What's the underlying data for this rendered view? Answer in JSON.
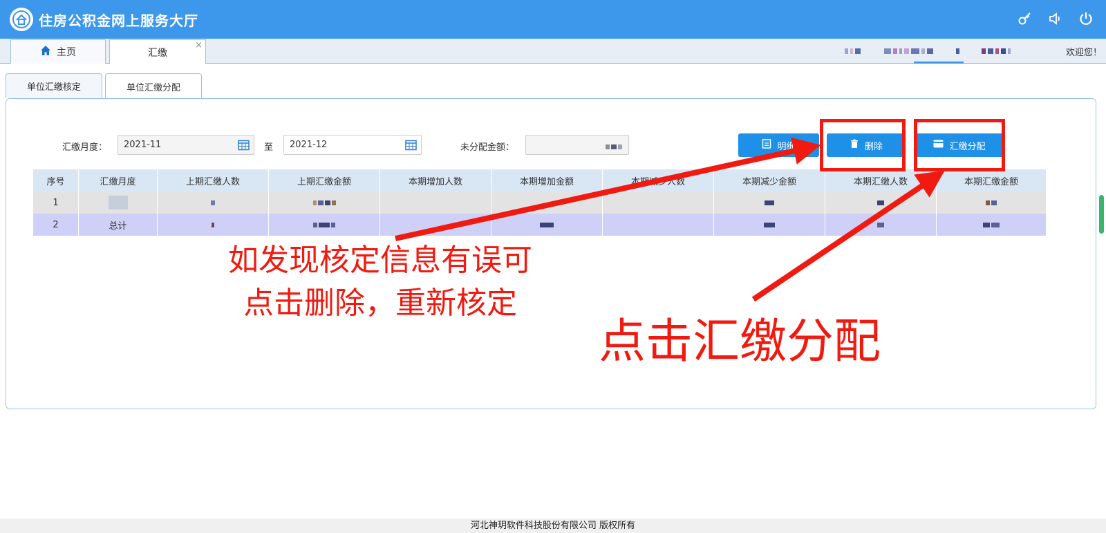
{
  "header": {
    "title": "住房公积金网上服务大厅",
    "icons": [
      "key-icon",
      "volume-icon",
      "power-icon"
    ],
    "color": "#3d97ea"
  },
  "top_tabs": [
    {
      "label": "主页",
      "icon": "home-icon"
    },
    {
      "label": "汇缴",
      "close": "×"
    }
  ],
  "welcome": "欢迎您！",
  "sub_tabs": [
    "单位汇缴核定",
    "单位汇缴分配"
  ],
  "filters": {
    "month_label": "汇缴月度：",
    "month_from": "2021-11",
    "to_label": "至",
    "month_to": "2021-12",
    "unallocated_label": "未分配金额："
  },
  "buttons": {
    "detail": "明细",
    "delete": "删除",
    "allocate": "汇缴分配"
  },
  "table": {
    "headers": [
      "序号",
      "汇缴月度",
      "上期汇缴人数",
      "上期汇缴金额",
      "本期增加人数",
      "本期增加金额",
      "本期减少人数",
      "本期减少金额",
      "本期汇缴人数",
      "本期汇缴金额"
    ],
    "rows": [
      [
        "1",
        "",
        "",
        "",
        "",
        "",
        "",
        "",
        "",
        ""
      ],
      [
        "2",
        "总计",
        "",
        "",
        "",
        "",
        "",
        "",
        "",
        ""
      ]
    ]
  },
  "annotations": {
    "delete_hint_line1": "如发现核定信息有误可",
    "delete_hint_line2": "点击删除，重新核定",
    "allocate_hint": "点击汇缴分配",
    "color": "#f01a10"
  },
  "footer": "河北神玥软件科技股份有限公司 版权所有"
}
